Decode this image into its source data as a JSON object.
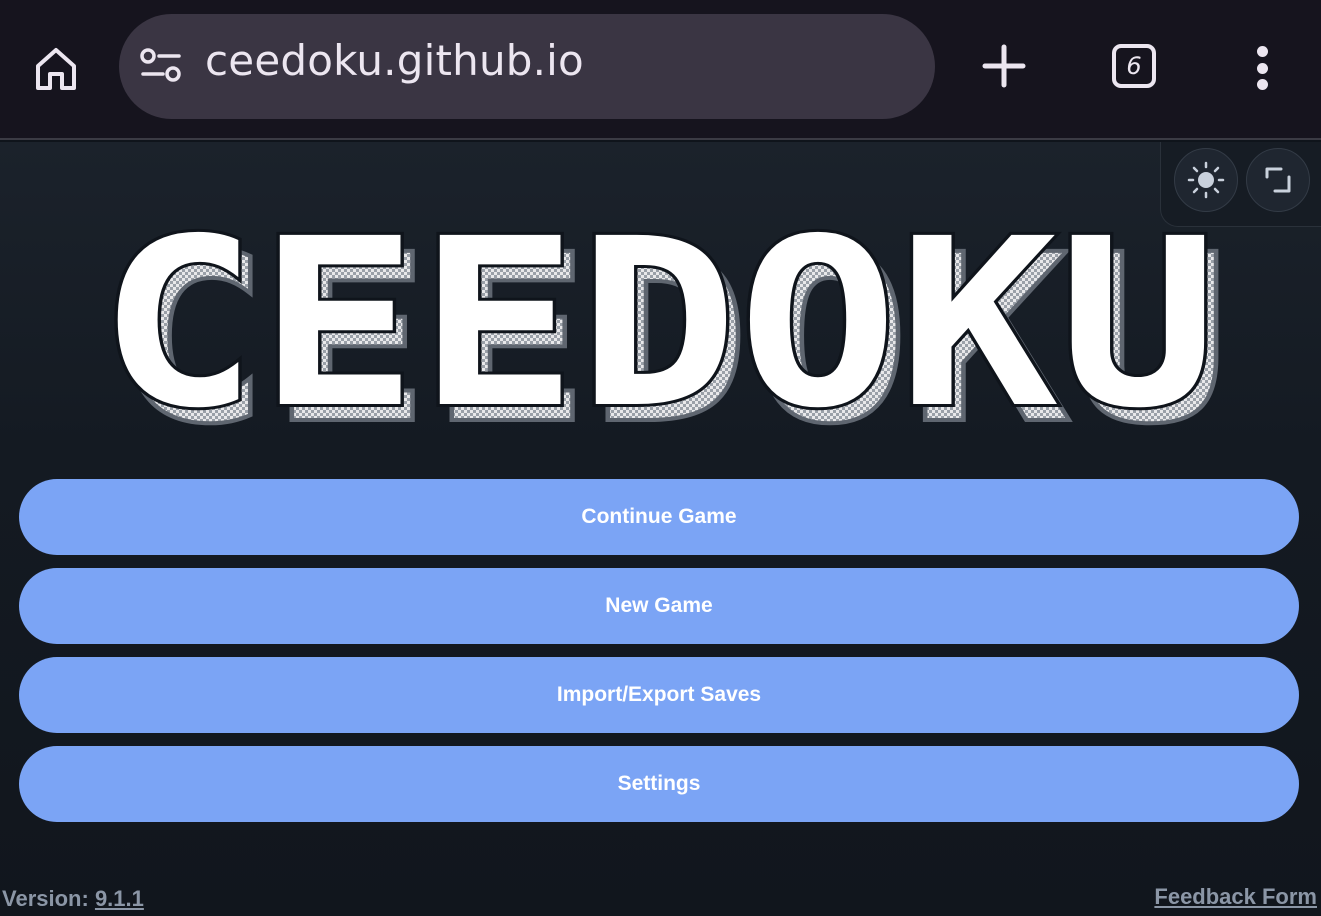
{
  "browser": {
    "url": "ceedoku.github.io",
    "tab_count": "6",
    "icons": {
      "home": "home-icon",
      "site_info": "site-settings-icon",
      "new_tab": "plus-icon",
      "menu": "more-vertical-icon"
    }
  },
  "app": {
    "logo_text": "CEEDOKU",
    "theme_toggle_icon": "sun-icon",
    "fullscreen_icon": "fullscreen-icon",
    "menu": [
      {
        "label": "Continue Game"
      },
      {
        "label": "New Game"
      },
      {
        "label": "Import/Export Saves"
      },
      {
        "label": "Settings"
      }
    ],
    "footer": {
      "version_label": "Version:",
      "version_value": "9.1.1",
      "feedback_label": "Feedback Form"
    },
    "colors": {
      "button": "#7ba4f5",
      "background": "#141a22",
      "footer_text": "#8b96a6"
    }
  }
}
